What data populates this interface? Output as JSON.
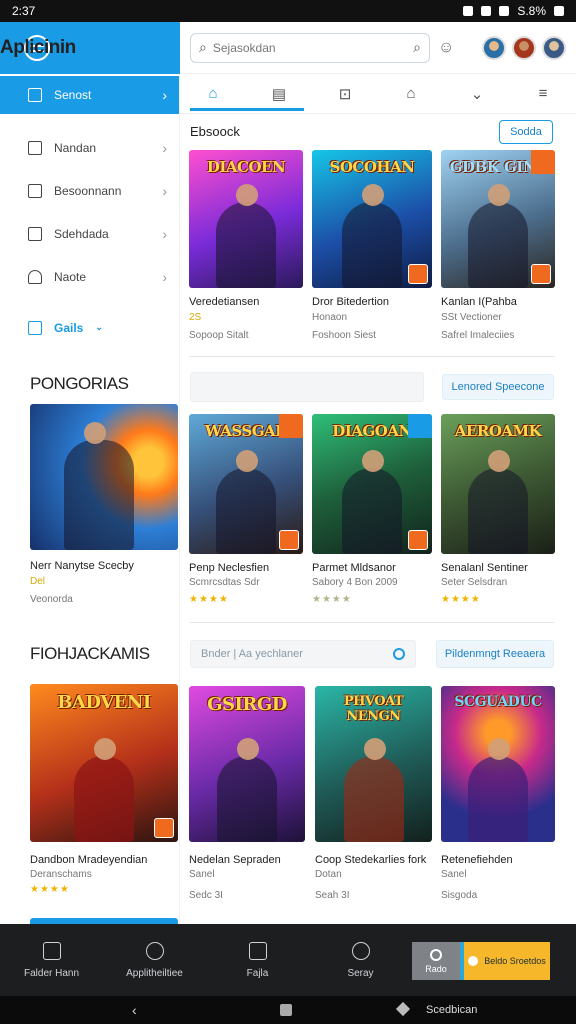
{
  "status": {
    "time": "2:37",
    "battery": "S.8%"
  },
  "app": {
    "title": "Aplicinin"
  },
  "search": {
    "placeholder": "Sejasokdan"
  },
  "sidebar": {
    "items": [
      {
        "label": "Senost",
        "active": true
      },
      {
        "label": "Nandan"
      },
      {
        "label": "Besoonnann"
      },
      {
        "label": "Sdehdada"
      },
      {
        "label": "Naote"
      },
      {
        "label": "Gails"
      }
    ]
  },
  "section1": {
    "heading": "Ebsoock",
    "button": "Sodda",
    "cards": [
      {
        "art": "DIACOEN",
        "title": "Veredetiansen",
        "sub": "2S",
        "meta": "Sopoop Sitalt"
      },
      {
        "art": "SOCOHAN",
        "title": "Dror Bitedertion",
        "sub": "Honaon",
        "meta": "Foshoon Siest"
      },
      {
        "art": "GDBK GINY",
        "title": "Kanlan I(Pahba",
        "sub": "SSt Vectioner",
        "meta": "Safrel Imaleciies"
      }
    ]
  },
  "section2": {
    "heading": "PONGORIAS",
    "button": "Lenored Speecone",
    "featured": {
      "title": "Nerr Nanytse Scecby",
      "sub": "Del",
      "meta": "Veonorda"
    },
    "cards": [
      {
        "art": "WASSGAR",
        "title": "Penp Neclesfien",
        "sub": "Scmrcsdtas Sdr",
        "stars": "★★★★",
        "grey": false
      },
      {
        "art": "DIAGOAN",
        "title": "Parmet Mldsanor",
        "sub": "Sabory 4 Bon 2009",
        "stars": "★★★★",
        "grey": true
      },
      {
        "art": "AEROAMK",
        "title": "Senalanl Sentiner",
        "sub": "Seter Selsdran",
        "stars": "★★★★",
        "grey": false
      }
    ]
  },
  "section3": {
    "heading": "FIOHJACKAMIS",
    "input": "Bnder | Aa yechlaner",
    "button": "Pildenmngt Reeaera",
    "cards": [
      {
        "art": "BADVENI",
        "title": "Dandbon Mradeyendian",
        "sub": "Deranschams",
        "stars": "★★★★"
      },
      {
        "art": "GSIRGD",
        "title": "Nedelan Sepraden",
        "sub": "Sanel",
        "meta": "Sedc 3I"
      },
      {
        "art": "PHVOAT NENGN",
        "title": "Coop Stedekarlies fork",
        "sub": "Dotan",
        "meta": "Seah 3I"
      },
      {
        "art": "SCGUADUC",
        "title": "Retenefiehden",
        "sub": "Sanel",
        "meta": "Sisgoda"
      }
    ]
  },
  "bottom_nav": {
    "items": [
      "Falder Hann",
      "Applitheiltiee",
      "Fajla",
      "Seray"
    ],
    "store": "Rado",
    "cta": "Beldo Sroetdos"
  },
  "system_nav": {
    "label": "Scedbican"
  }
}
